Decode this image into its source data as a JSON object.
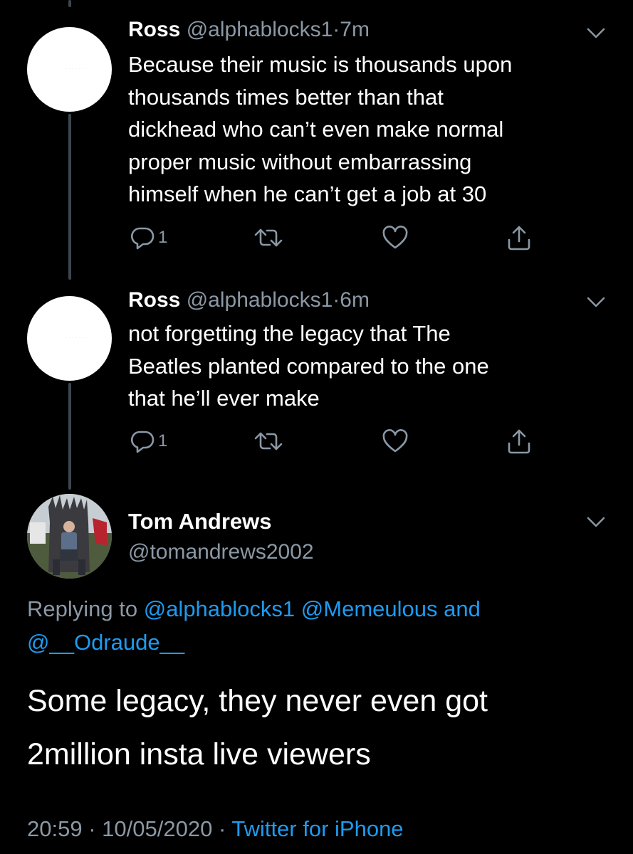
{
  "tweets": [
    {
      "name": "Ross",
      "handle": "@alphablocks1",
      "time_separator": "·",
      "time": "7m",
      "text_lines": [
        "Because their music is thousands upon",
        "thousands times better than that",
        "dickhead who can’t even make normal",
        "proper music without embarrassing",
        "himself when he can’t get a job at 30"
      ],
      "reply_count": "1",
      "icons": [
        "reply-icon",
        "retweet-icon",
        "like-icon",
        "share-icon",
        "chevron-down-icon"
      ]
    },
    {
      "name": "Ross",
      "handle": "@alphablocks1",
      "time_separator": "·",
      "time": "6m",
      "text_lines": [
        "not forgetting the legacy that The",
        "Beatles planted compared to the one",
        "that he’ll ever make"
      ],
      "reply_count": "1",
      "icons": [
        "reply-icon",
        "retweet-icon",
        "like-icon",
        "share-icon",
        "chevron-down-icon"
      ]
    }
  ],
  "main_tweet": {
    "name": "Tom Andrews",
    "handle": "@tomandrews2002",
    "replying": {
      "prefix": "Replying to",
      "mention_1": "@alphablocks1",
      "mention_2": "@Memeulous",
      "conjunction": "and",
      "mention_3": "@__Odraude__"
    },
    "text_lines": [
      "Some legacy, they never even got",
      "2million insta live viewers"
    ],
    "time": "20:59",
    "separator": "·",
    "date": "10/05/2020",
    "source": "Twitter for iPhone"
  },
  "colors": {
    "background": "#000000",
    "text": "#ffffff",
    "secondary_text": "#8b98a5",
    "link": "#1d9bf0",
    "thread_line": "#3d4650"
  }
}
